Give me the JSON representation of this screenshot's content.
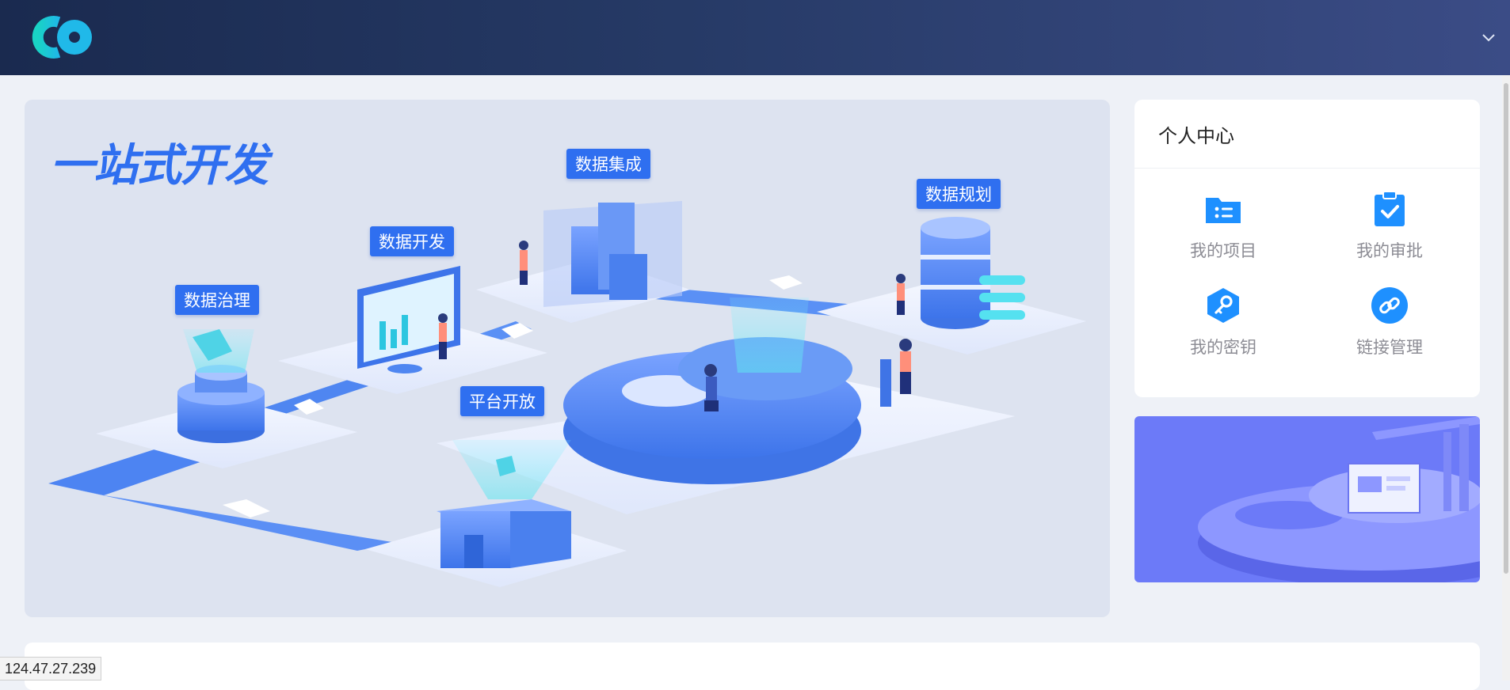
{
  "header": {
    "logo_icon": "co-logo-icon",
    "dropdown_icon": "chevron-down-icon"
  },
  "hero": {
    "title": "一站式开发",
    "modules": {
      "integration": "数据集成",
      "planning": "数据规划",
      "development": "数据开发",
      "governance": "数据治理",
      "open_platform": "平台开放"
    }
  },
  "personal_center": {
    "title": "个人中心",
    "items": [
      {
        "label": "我的项目",
        "icon": "folder-list-icon"
      },
      {
        "label": "我的审批",
        "icon": "clipboard-check-icon"
      },
      {
        "label": "我的密钥",
        "icon": "key-icon"
      },
      {
        "label": "链接管理",
        "icon": "link-icon"
      }
    ]
  },
  "status_bar": {
    "url": "124.47.27.239"
  },
  "colors": {
    "accent": "#2f6ff0",
    "header_start": "#1a2a4f",
    "header_end": "#3b4c86",
    "banner": "#6c7af8",
    "icon_blue": "#1e90ff"
  }
}
